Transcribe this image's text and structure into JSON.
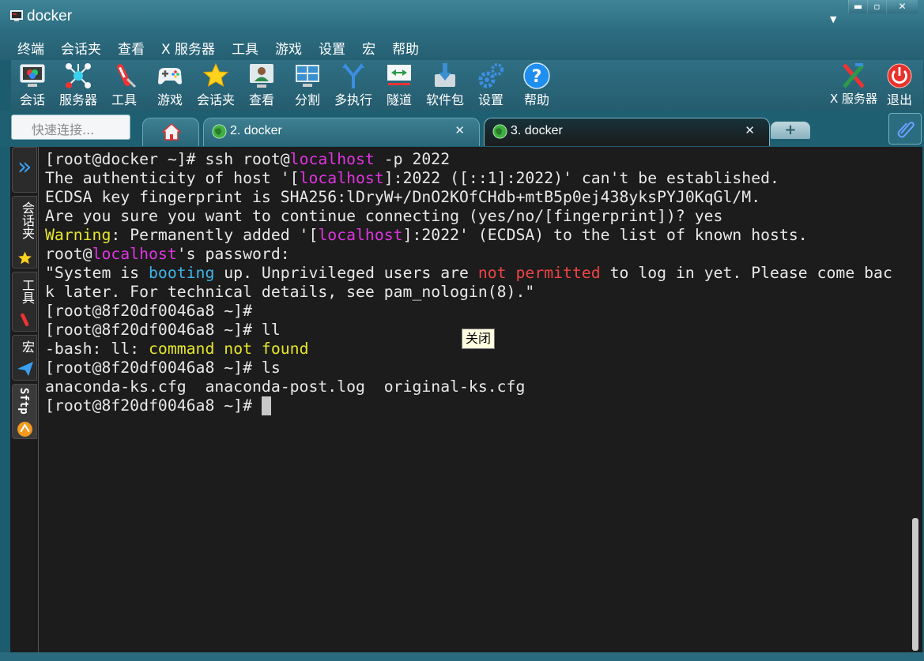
{
  "window": {
    "title": "docker",
    "controls": {
      "minimize": "▬",
      "maximize": "▫",
      "close": "✕"
    }
  },
  "menu": [
    "终端",
    "会话夹",
    "查看",
    "X 服务器",
    "工具",
    "游戏",
    "设置",
    "宏",
    "帮助"
  ],
  "toolbar": {
    "items": [
      {
        "label": "会话",
        "icon": "session-icon"
      },
      {
        "label": "服务器",
        "icon": "servers-icon"
      },
      {
        "label": "工具",
        "icon": "tools-icon"
      },
      {
        "label": "游戏",
        "icon": "gamepad-icon"
      },
      {
        "label": "会话夹",
        "icon": "star-icon"
      },
      {
        "label": "查看",
        "icon": "view-icon"
      },
      {
        "label": "分割",
        "icon": "split-icon"
      },
      {
        "label": "多执行",
        "icon": "multiexec-icon"
      },
      {
        "label": "隧道",
        "icon": "tunnel-icon"
      },
      {
        "label": "软件包",
        "icon": "packages-icon"
      },
      {
        "label": "设置",
        "icon": "gears-icon"
      },
      {
        "label": "帮助",
        "icon": "help-icon"
      }
    ],
    "xserver_label": "X 服务器",
    "exit_label": "退出"
  },
  "tabs": {
    "quick_connect_placeholder": "快速连接...",
    "items": [
      {
        "label": "2. docker",
        "close": "✕"
      },
      {
        "label": "3. docker",
        "close": "✕"
      }
    ],
    "new_tab": "+"
  },
  "sidebar": {
    "collapse": "»",
    "tabs": [
      "会话夹",
      "工具",
      "宏",
      "Sftp"
    ]
  },
  "colors": {
    "frame": "#1d5c6e",
    "terminal_bg": "#1c1c1c",
    "hostname": "#e034e0",
    "warning": "#e6e62a",
    "info": "#3fb4e8",
    "error": "#ee4444"
  },
  "terminal": {
    "lines": [
      [
        {
          "t": "[root@docker ~]# ssh root@"
        },
        {
          "t": "localhost",
          "c": "mag"
        },
        {
          "t": " -p 2022"
        }
      ],
      [
        {
          "t": "The authenticity of host '["
        },
        {
          "t": "localhost",
          "c": "mag"
        },
        {
          "t": "]:2022 ([::1]:2022)' can't be established."
        }
      ],
      [
        {
          "t": "ECDSA key fingerprint is SHA256:lDryW+/DnO2KOfCHdb+mtB5p0ej438yksPYJ0KqGl/M."
        }
      ],
      [
        {
          "t": "Are you sure you want to continue connecting (yes/no/[fingerprint])? yes"
        }
      ],
      [
        {
          "t": "Warning",
          "c": "yel"
        },
        {
          "t": ": Permanently added '["
        },
        {
          "t": "localhost",
          "c": "mag"
        },
        {
          "t": "]:2022' (ECDSA) to the list of known hosts."
        }
      ],
      [
        {
          "t": "root@"
        },
        {
          "t": "localhost",
          "c": "mag"
        },
        {
          "t": "'s password:"
        }
      ],
      [
        {
          "t": "\"System is "
        },
        {
          "t": "booting",
          "c": "cyan"
        },
        {
          "t": " up. Unprivileged users are "
        },
        {
          "t": "not permitted",
          "c": "red"
        },
        {
          "t": " to log in yet. Please come bac"
        }
      ],
      [
        {
          "t": "k later. For technical details, see pam_nologin(8).\""
        }
      ],
      [
        {
          "t": "[root@8f20df0046a8 ~]#"
        }
      ],
      [
        {
          "t": "[root@8f20df0046a8 ~]# ll"
        }
      ],
      [
        {
          "t": "-bash: ll: "
        },
        {
          "t": "command not found",
          "c": "yel"
        }
      ],
      [
        {
          "t": "[root@8f20df0046a8 ~]# ls"
        }
      ],
      [
        {
          "t": "anaconda-ks.cfg  anaconda-post.log  original-ks.cfg"
        }
      ],
      [
        {
          "t": "[root@8f20df0046a8 ~]# "
        },
        {
          "cursor": true
        }
      ]
    ]
  },
  "tooltip": "关闭"
}
